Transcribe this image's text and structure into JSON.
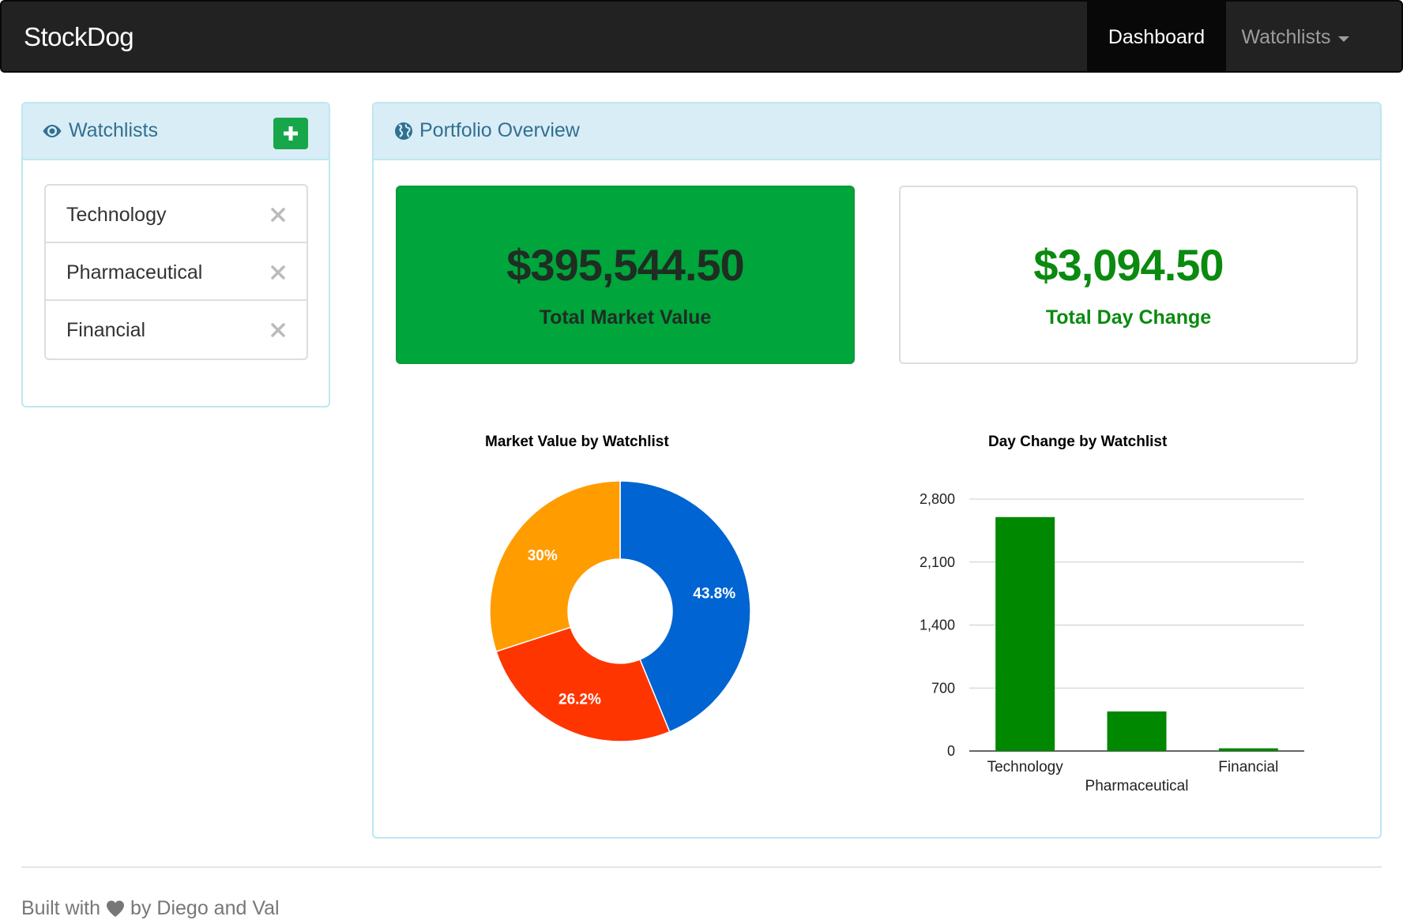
{
  "navbar": {
    "brand": "StockDog",
    "items": [
      {
        "label": "Dashboard",
        "active": true
      },
      {
        "label": "Watchlists",
        "dropdown": true
      }
    ]
  },
  "watchlists_panel": {
    "title": "Watchlists",
    "title_icon": "eye-icon",
    "add_icon": "plus-icon",
    "items": [
      {
        "label": "Technology",
        "remove_icon": "close-icon"
      },
      {
        "label": "Pharmaceutical",
        "remove_icon": "close-icon"
      },
      {
        "label": "Financial",
        "remove_icon": "close-icon"
      }
    ]
  },
  "portfolio_panel": {
    "title": "Portfolio Overview",
    "title_icon": "globe-icon",
    "market_value": {
      "value": "$395,544.50",
      "label": "Total Market Value"
    },
    "day_change": {
      "value": "$3,094.50",
      "label": "Total Day Change"
    }
  },
  "chart_data": [
    {
      "type": "pie",
      "title": "Market Value by Watchlist",
      "donut": true,
      "slices": [
        {
          "value": 43.8,
          "label": "43.8%",
          "color": "#0064d2"
        },
        {
          "value": 26.2,
          "label": "26.2%",
          "color": "#ff3500"
        },
        {
          "value": 30.0,
          "label": "30%",
          "color": "#ff9c00"
        }
      ]
    },
    {
      "type": "bar",
      "title": "Day Change by Watchlist",
      "categories": [
        "Technology",
        "Pharmaceutical",
        "Financial"
      ],
      "values": [
        2600,
        440,
        30
      ],
      "color": "#008800",
      "ylim": [
        0,
        2800
      ],
      "yticks": [
        0,
        700,
        1400,
        2100,
        2800
      ],
      "ytick_labels": [
        "0",
        "700",
        "1,400",
        "2,100",
        "2,800"
      ],
      "grid": true
    }
  ],
  "colors": {
    "navbar_bg": "#222222",
    "panel_heading_bg": "#d9edf7",
    "panel_title": "#31708f",
    "market_box": "#00a53c",
    "day_change_text": "#0b8a10",
    "add_button": "#18a64a"
  },
  "footer": {
    "prefix": "Built with",
    "icon": "heart-icon",
    "suffix": "by Diego and Val"
  }
}
